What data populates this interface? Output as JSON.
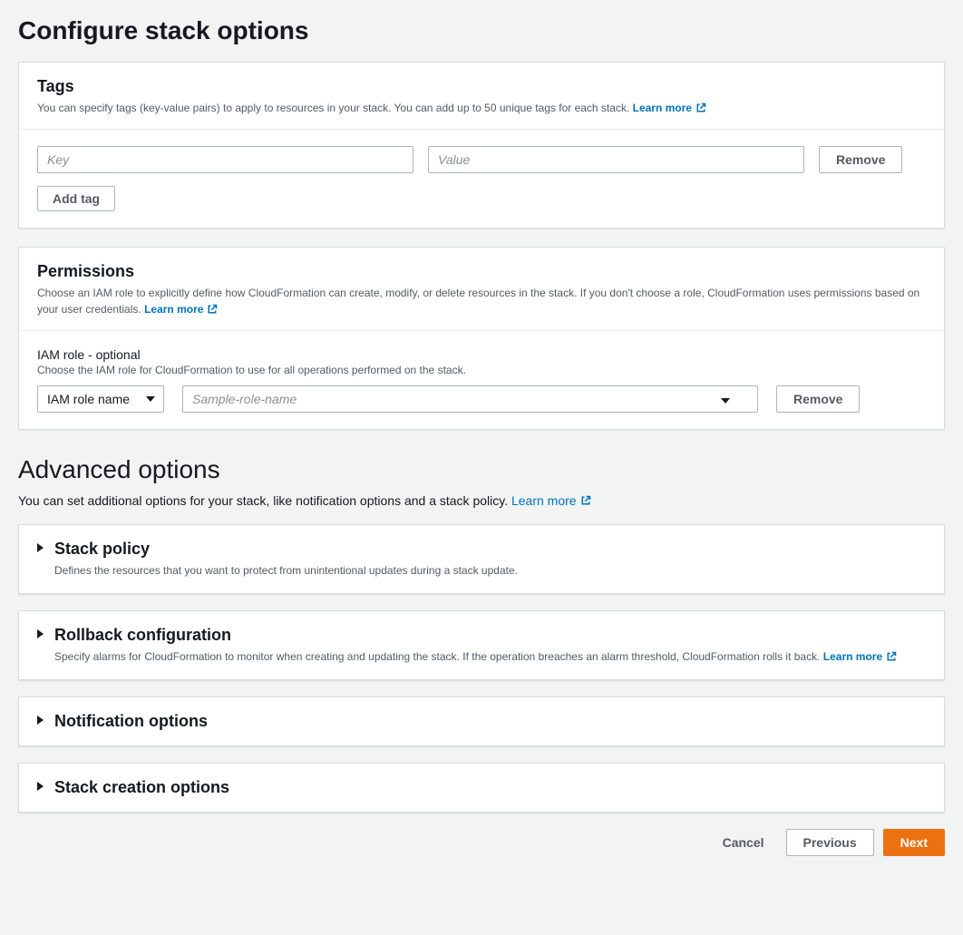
{
  "page": {
    "title": "Configure stack options"
  },
  "tags": {
    "title": "Tags",
    "desc": "You can specify tags (key-value pairs) to apply to resources in your stack. You can add up to 50 unique tags for each stack.",
    "learn_more": "Learn more",
    "key_placeholder": "Key",
    "value_placeholder": "Value",
    "remove_label": "Remove",
    "add_label": "Add tag"
  },
  "permissions": {
    "title": "Permissions",
    "desc": "Choose an IAM role to explicitly define how CloudFormation can create, modify, or delete resources in the stack. If you don't choose a role, CloudFormation uses permissions based on your user credentials.",
    "learn_more": "Learn more",
    "field_label": "IAM role - optional",
    "field_sub": "Choose the IAM role for CloudFormation to use for all operations performed on the stack.",
    "select_value": "IAM role name",
    "combo_placeholder": "Sample-role-name",
    "remove_label": "Remove"
  },
  "advanced": {
    "title": "Advanced options",
    "desc": "You can set additional options for your stack, like notification options and a stack policy.",
    "learn_more": "Learn more",
    "sections": [
      {
        "title": "Stack policy",
        "desc": "Defines the resources that you want to protect from unintentional updates during a stack update."
      },
      {
        "title": "Rollback configuration",
        "desc": "Specify alarms for CloudFormation to monitor when creating and updating the stack. If the operation breaches an alarm threshold, CloudFormation rolls it back.",
        "learn_more": "Learn more"
      },
      {
        "title": "Notification options"
      },
      {
        "title": "Stack creation options"
      }
    ]
  },
  "footer": {
    "cancel": "Cancel",
    "previous": "Previous",
    "next": "Next"
  }
}
